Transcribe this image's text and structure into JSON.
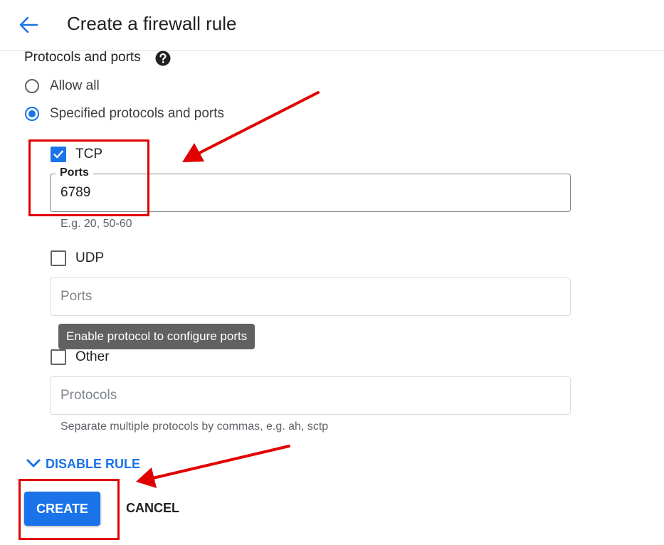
{
  "header": {
    "title": "Create a firewall rule"
  },
  "protocols": {
    "section_title": "Protocols and ports",
    "options": [
      {
        "label": "Allow all",
        "selected": false
      },
      {
        "label": "Specified protocols and ports",
        "selected": true
      }
    ]
  },
  "tcp": {
    "label": "TCP",
    "checked": true,
    "ports_legend": "Ports",
    "ports_value": "6789",
    "hint": "E.g. 20, 50-60"
  },
  "udp": {
    "label": "UDP",
    "checked": false,
    "ports_placeholder": "Ports"
  },
  "tooltip": {
    "text": "Enable protocol to configure ports"
  },
  "other": {
    "label": "Other",
    "checked": false,
    "protocols_placeholder": "Protocols",
    "hint": "Separate multiple protocols by commas, e.g. ah, sctp"
  },
  "actions": {
    "disable_rule": "DISABLE RULE",
    "create": "CREATE",
    "cancel": "CANCEL"
  },
  "colors": {
    "accent": "#1a73e8",
    "annotation": "#e10000",
    "tooltip_bg": "#616161"
  }
}
